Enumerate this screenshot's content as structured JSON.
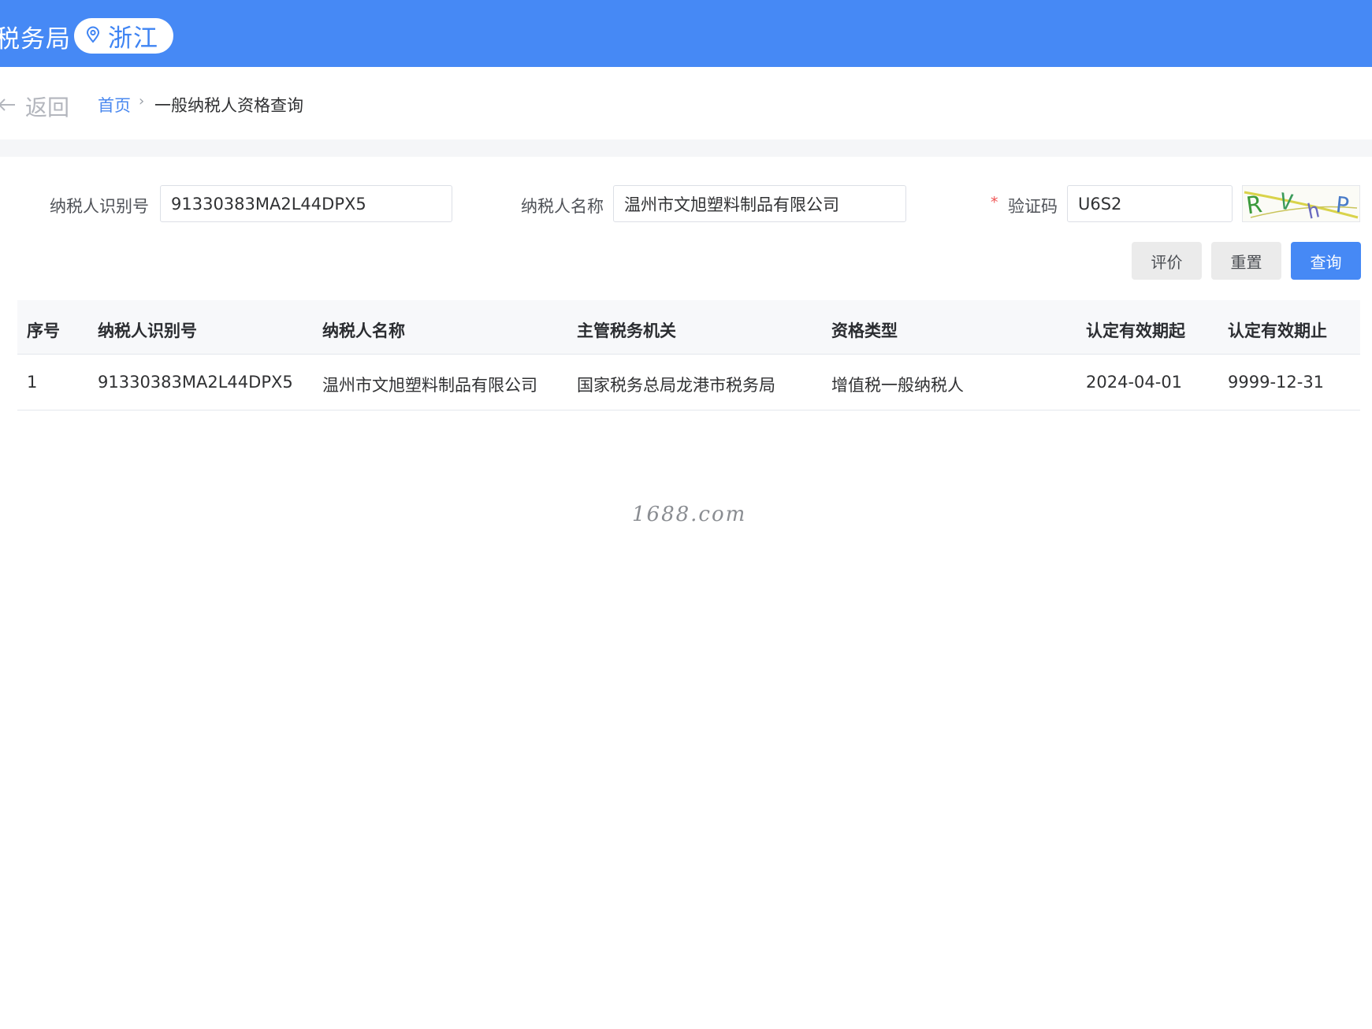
{
  "header": {
    "brand": "税务局",
    "region": "浙江"
  },
  "nav": {
    "back_label": "返回",
    "breadcrumb": {
      "home": "首页",
      "separator": "›",
      "current": "一般纳税人资格查询"
    }
  },
  "form": {
    "taxpayer_id": {
      "label": "纳税人识别号",
      "value": "91330383MA2L44DPX5"
    },
    "taxpayer_name": {
      "label": "纳税人名称",
      "value": "温州市文旭塑料制品有限公司"
    },
    "captcha": {
      "required_mark": "*",
      "label": "验证码",
      "value": "U6S2",
      "image_text": "RVhP"
    }
  },
  "buttons": {
    "evaluate": "评价",
    "reset": "重置",
    "query": "查询"
  },
  "table": {
    "columns": [
      "序号",
      "纳税人识别号",
      "纳税人名称",
      "主管税务机关",
      "资格类型",
      "认定有效期起",
      "认定有效期止"
    ],
    "rows": [
      [
        "1",
        "91330383MA2L44DPX5",
        "温州市文旭塑料制品有限公司",
        "国家税务总局龙港市税务局",
        "增值税一般纳税人",
        "2024-04-01",
        "9999-12-31"
      ]
    ]
  },
  "watermark": "1688.com",
  "colors": {
    "primary": "#4689f5",
    "link": "#4a88ef",
    "required": "#f05454"
  }
}
